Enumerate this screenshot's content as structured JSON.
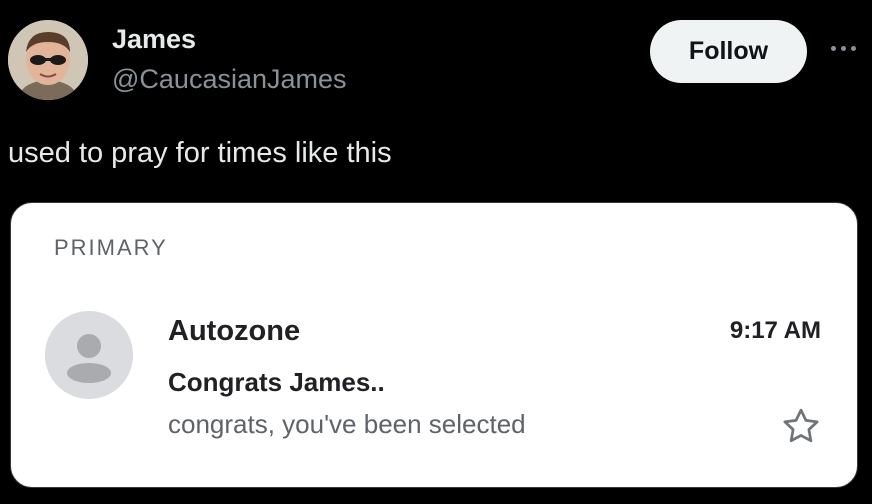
{
  "author": {
    "name": "James",
    "handle": "@CaucasianJames",
    "avatar_icon": "profile-photo-man-sunglasses"
  },
  "actions": {
    "follow_label": "Follow",
    "more_icon": "more-horizontal-icon"
  },
  "tweet": {
    "text": "used to pray for times like this"
  },
  "email_screenshot": {
    "section_label": "PRIMARY",
    "sender": "Autozone",
    "time": "9:17 AM",
    "subject": "Congrats James..",
    "snippet": "congrats, you've been selected",
    "avatar_icon": "default-person-icon",
    "star_icon": "star-outline-icon"
  },
  "colors": {
    "background": "#000000",
    "text_primary": "#e7e9ea",
    "text_secondary": "#8b9197",
    "follow_bg": "#eff3f4",
    "card_bg": "#ffffff",
    "gmail_gray": "#5f6368"
  }
}
